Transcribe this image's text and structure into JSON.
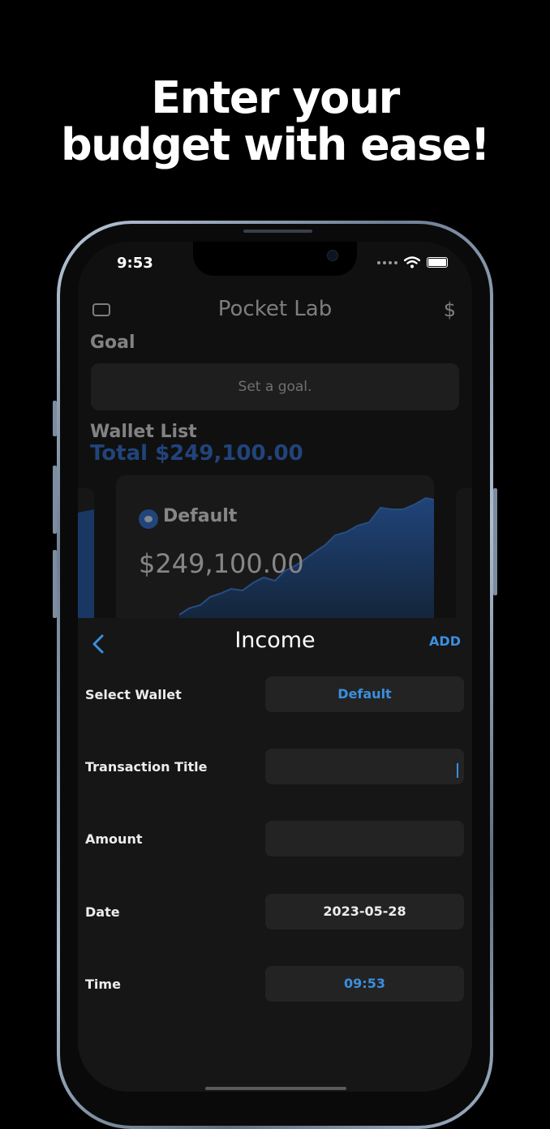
{
  "promo": {
    "line1": "Enter your",
    "line2": "budget with ease!"
  },
  "status_bar": {
    "time": "9:53"
  },
  "background_app": {
    "title": "Pocket Lab",
    "goal_heading": "Goal",
    "goal_placeholder": "Set a goal.",
    "wallet_list_heading": "Wallet List",
    "total": "Total $249,100.00",
    "wallet_card": {
      "name": "Default",
      "balance": "$249,100.00"
    }
  },
  "sheet": {
    "title": "Income",
    "add_label": "ADD",
    "fields": {
      "wallet_label": "Select Wallet",
      "wallet_value": "Default",
      "title_label": "Transaction Title",
      "title_value": "",
      "amount_label": "Amount",
      "amount_value": "",
      "date_label": "Date",
      "date_value": "2023-05-28",
      "time_label": "Time",
      "time_value": "09:53"
    }
  },
  "colors": {
    "accent": "#3a8fde",
    "total_blue": "#2f6fd4",
    "background": "#000000",
    "sheet": "#161616",
    "field": "#232323"
  }
}
